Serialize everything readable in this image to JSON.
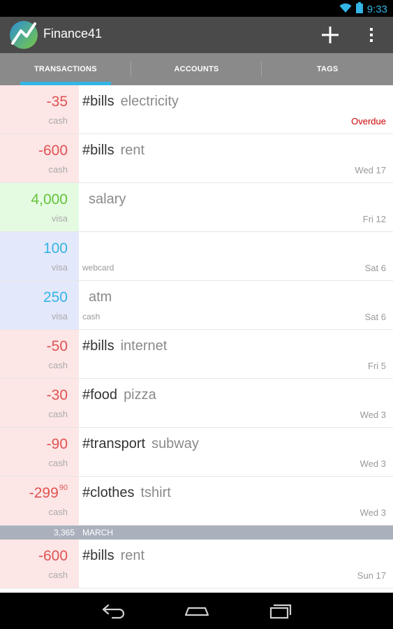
{
  "status_bar": {
    "time": "9:33"
  },
  "app": {
    "title": "Finance41"
  },
  "tabs": [
    {
      "label": "TRANSACTIONS",
      "active": true
    },
    {
      "label": "ACCOUNTS",
      "active": false
    },
    {
      "label": "TAGS",
      "active": false
    }
  ],
  "colors": {
    "accent": "#33b5e5",
    "negative": "#e05252",
    "positive": "#66c23a",
    "overdue": "#cc0000"
  },
  "transactions": [
    {
      "kind": "expense",
      "amount": "-35",
      "account": "cash",
      "tag": "#bills",
      "note": "electricity",
      "date": "Overdue"
    },
    {
      "kind": "expense",
      "amount": "-600",
      "account": "cash",
      "tag": "#bills",
      "note": "rent",
      "date": "Wed 17"
    },
    {
      "kind": "income",
      "amount": "4,000",
      "account": "visa",
      "tag": "",
      "note": "salary",
      "date": "Fri 12"
    },
    {
      "kind": "transfer",
      "amount": "100",
      "account": "visa",
      "tag": "",
      "note": "",
      "sub_account": "webcard",
      "date": "Sat 6"
    },
    {
      "kind": "transfer",
      "amount": "250",
      "account": "visa",
      "tag": "",
      "note": "atm",
      "sub_account": "cash",
      "date": "Sat 6"
    },
    {
      "kind": "expense",
      "amount": "-50",
      "account": "cash",
      "tag": "#bills",
      "note": "internet",
      "date": "Fri 5"
    },
    {
      "kind": "expense",
      "amount": "-30",
      "account": "cash",
      "tag": "#food",
      "note": "pizza",
      "date": "Wed 3"
    },
    {
      "kind": "expense",
      "amount": "-90",
      "account": "cash",
      "tag": "#transport",
      "note": "subway",
      "date": "Wed 3"
    },
    {
      "kind": "expense",
      "amount": "-299",
      "cents": "90",
      "account": "cash",
      "tag": "#clothes",
      "note": "tshirt",
      "date": "Wed 3"
    }
  ],
  "section": {
    "total": "3,365",
    "name": "MARCH"
  },
  "march_transactions": [
    {
      "kind": "expense",
      "amount": "-600",
      "account": "cash",
      "tag": "#bills",
      "note": "rent",
      "date": "Sun 17"
    }
  ],
  "icons": {
    "wifi": "wifi-icon",
    "battery": "battery-icon",
    "logo": "finance41-logo-icon",
    "add": "add-icon",
    "overflow": "overflow-menu-icon",
    "back": "back-icon",
    "home": "home-icon",
    "recents": "recents-icon"
  }
}
